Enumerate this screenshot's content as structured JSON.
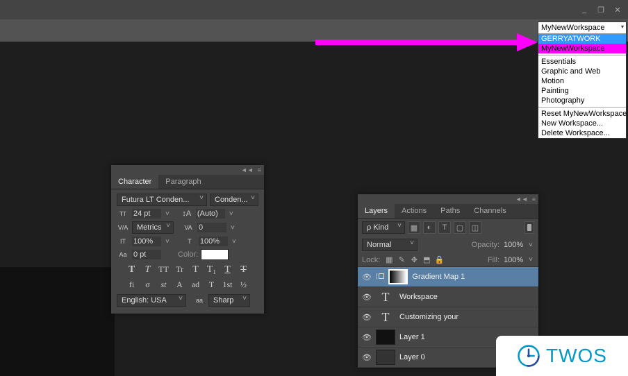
{
  "window": {
    "minimize": "_",
    "maximize": "❐",
    "close": "✕"
  },
  "workspace": {
    "selected": "MyNewWorkspace",
    "recent": [
      "GERRYATWORK",
      "MyNewWorkspace"
    ],
    "presets": [
      "Essentials",
      "Graphic and Web",
      "Motion",
      "Painting",
      "Photography"
    ],
    "actions": [
      "Reset MyNewWorkspace",
      "New Workspace...",
      "Delete Workspace..."
    ]
  },
  "characterPanel": {
    "tabs": [
      "Character",
      "Paragraph"
    ],
    "font": "Futura LT Conden...",
    "style": "Conden...",
    "size_label": "T",
    "size": "24 pt",
    "leading_label": "A",
    "leading": "(Auto)",
    "va_label": "V/A",
    "kerning": "Metrics",
    "tracking_label": "VA",
    "tracking": "0",
    "vscale_label": "IT",
    "vscale": "100%",
    "hscale_label": "T",
    "hscale": "100%",
    "baseline_label": "Aa",
    "baseline": "0 pt",
    "color_label": "Color:",
    "color": "#ffffff",
    "style_buttons": [
      "T",
      "T",
      "TT",
      "Tr",
      "T",
      "T₁",
      "T",
      "T"
    ],
    "feature_buttons": [
      "fi",
      "σ",
      "st",
      "A",
      "ad",
      "T",
      "1st",
      "½"
    ],
    "language": "English: USA",
    "aa_icon": "aa",
    "aa": "Sharp",
    "collapse": "◄◄",
    "menu": "≡"
  },
  "layersPanel": {
    "tabs": [
      "Layers",
      "Actions",
      "Paths",
      "Channels"
    ],
    "filter_label": "ρ Kind",
    "filter_icons": [
      "▦",
      "◐",
      "T",
      "▢",
      "◫",
      "✦"
    ],
    "blend_mode": "Normal",
    "opacity_label": "Opacity:",
    "opacity": "100%",
    "lock_label": "Lock:",
    "lock_icons": [
      "▦",
      "✎",
      "✥",
      "⬒",
      "🔒"
    ],
    "fill_label": "Fill:",
    "fill": "100%",
    "layers": [
      {
        "name": "Gradient Map 1",
        "type": "adjustment",
        "selected": true,
        "visible": true,
        "linked": true
      },
      {
        "name": "Workspace",
        "type": "text",
        "selected": false,
        "visible": true
      },
      {
        "name": "Customizing your",
        "type": "text",
        "selected": false,
        "visible": true
      },
      {
        "name": "Layer 1",
        "type": "pixel",
        "selected": false,
        "visible": true
      },
      {
        "name": "Layer 0",
        "type": "image",
        "selected": false,
        "visible": true
      }
    ],
    "collapse": "◄◄",
    "menu": "≡"
  },
  "logo": "TWOS"
}
